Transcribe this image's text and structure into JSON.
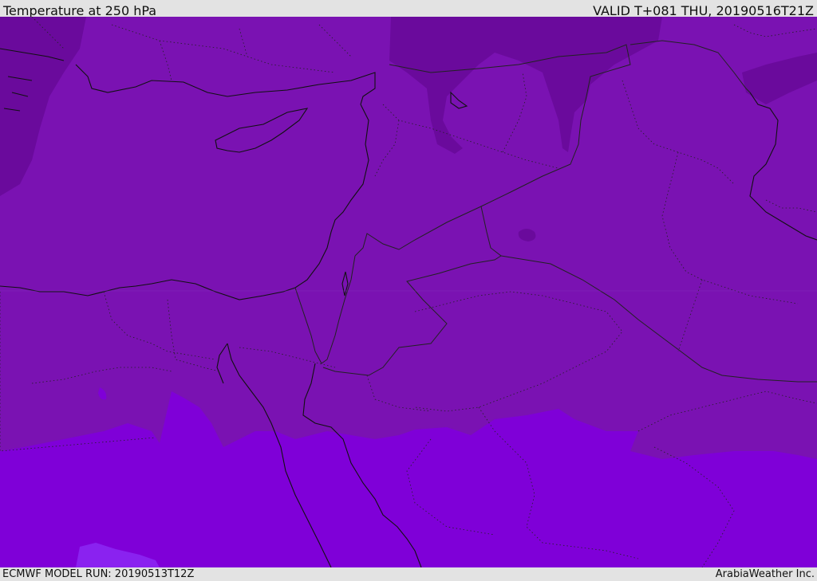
{
  "header": {
    "title": "Temperature at 250 hPa",
    "valid": "VALID T+081 THU, 20190516T21Z"
  },
  "footer": {
    "model_run": "ECMWF MODEL RUN: 20190513T12Z",
    "credit": "ArabiaWeather Inc."
  },
  "colors": {
    "cold_band": "#6a0a9c",
    "mid_band": "#7a12b2",
    "warm_band": "#7f00d8",
    "warmest_band": "#8a22f0",
    "coastline": "#111111",
    "borders": "#222222"
  }
}
